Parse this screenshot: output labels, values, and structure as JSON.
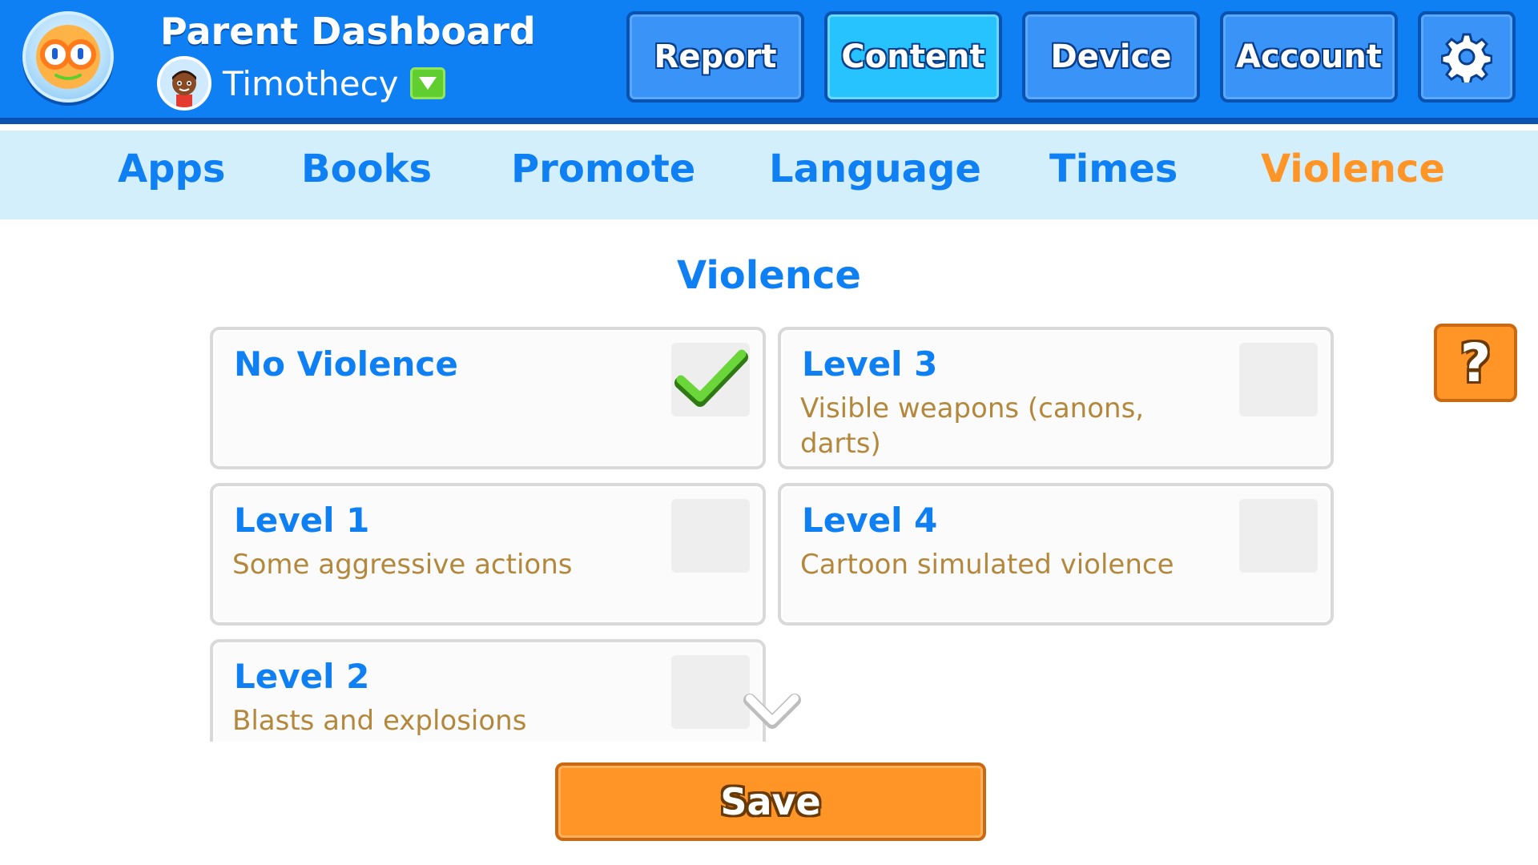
{
  "header": {
    "title": "Parent Dashboard",
    "child_name": "Timothecy",
    "logo_icon": "goggle-eyes-logo-icon",
    "avatar_icon": "child-avatar-icon",
    "dropdown_icon": "triangle-down-icon",
    "nav": [
      {
        "label": "Report",
        "active": false
      },
      {
        "label": "Content",
        "active": true
      },
      {
        "label": "Device",
        "active": false
      },
      {
        "label": "Account",
        "active": false
      }
    ],
    "settings_icon": "gear-icon"
  },
  "subtabs": [
    {
      "label": "Apps",
      "active": false
    },
    {
      "label": "Books",
      "active": false
    },
    {
      "label": "Promote",
      "active": false
    },
    {
      "label": "Language",
      "active": false
    },
    {
      "label": "Times",
      "active": false
    },
    {
      "label": "Violence",
      "active": true
    }
  ],
  "main": {
    "section_title": "Violence",
    "options": [
      {
        "title": "No Violence",
        "description": "",
        "checked": true
      },
      {
        "title": "Level 3",
        "description": "Visible weapons (canons, darts)",
        "checked": false
      },
      {
        "title": "Level 1",
        "description": "Some aggressive actions",
        "checked": false
      },
      {
        "title": "Level 4",
        "description": "Cartoon simulated violence",
        "checked": false
      },
      {
        "title": "Level 2",
        "description": "Blasts and explosions",
        "checked": false
      }
    ],
    "help_label": "?",
    "save_label": "Save",
    "scroll_icon": "chevron-down-icon"
  },
  "colors": {
    "header_blue": "#0f7ff4",
    "active_nav": "#27c3ff",
    "subtab_bg": "#d4effc",
    "accent_orange": "#ff9427",
    "description_brown": "#b3883d",
    "check_green": "#5fce2e"
  }
}
